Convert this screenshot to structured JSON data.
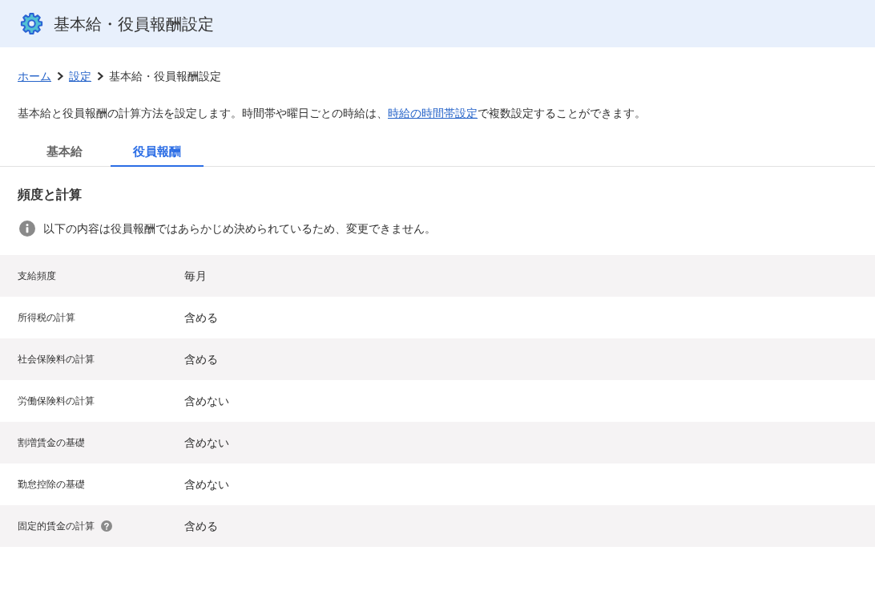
{
  "header": {
    "title": "基本給・役員報酬設定"
  },
  "breadcrumb": [
    {
      "label": "ホーム",
      "kind": "link"
    },
    {
      "label": "設定",
      "kind": "link"
    },
    {
      "label": "基本給・役員報酬設定",
      "kind": "current"
    }
  ],
  "description": {
    "before": "基本給と役員報酬の計算方法を設定します。時間帯や曜日ごとの時給は、",
    "link": "時給の時間帯設定",
    "after": "で複数設定することができます。"
  },
  "tabs": [
    {
      "label": "基本給",
      "selected": false
    },
    {
      "label": "役員報酬",
      "selected": true
    }
  ],
  "section": {
    "title": "頻度と計算",
    "notice": "以下の内容は役員報酬ではあらかじめ決められているため、変更できません。"
  },
  "rows": [
    {
      "label": "支給頻度",
      "value": "毎月",
      "help": false
    },
    {
      "label": "所得税の計算",
      "value": "含める",
      "help": false
    },
    {
      "label": "社会保険料の計算",
      "value": "含める",
      "help": false
    },
    {
      "label": "労働保険料の計算",
      "value": "含めない",
      "help": false
    },
    {
      "label": "割増賃金の基礎",
      "value": "含めない",
      "help": false
    },
    {
      "label": "勤怠控除の基礎",
      "value": "含めない",
      "help": false
    },
    {
      "label": "固定的賃金の計算",
      "value": "含める",
      "help": true
    }
  ]
}
